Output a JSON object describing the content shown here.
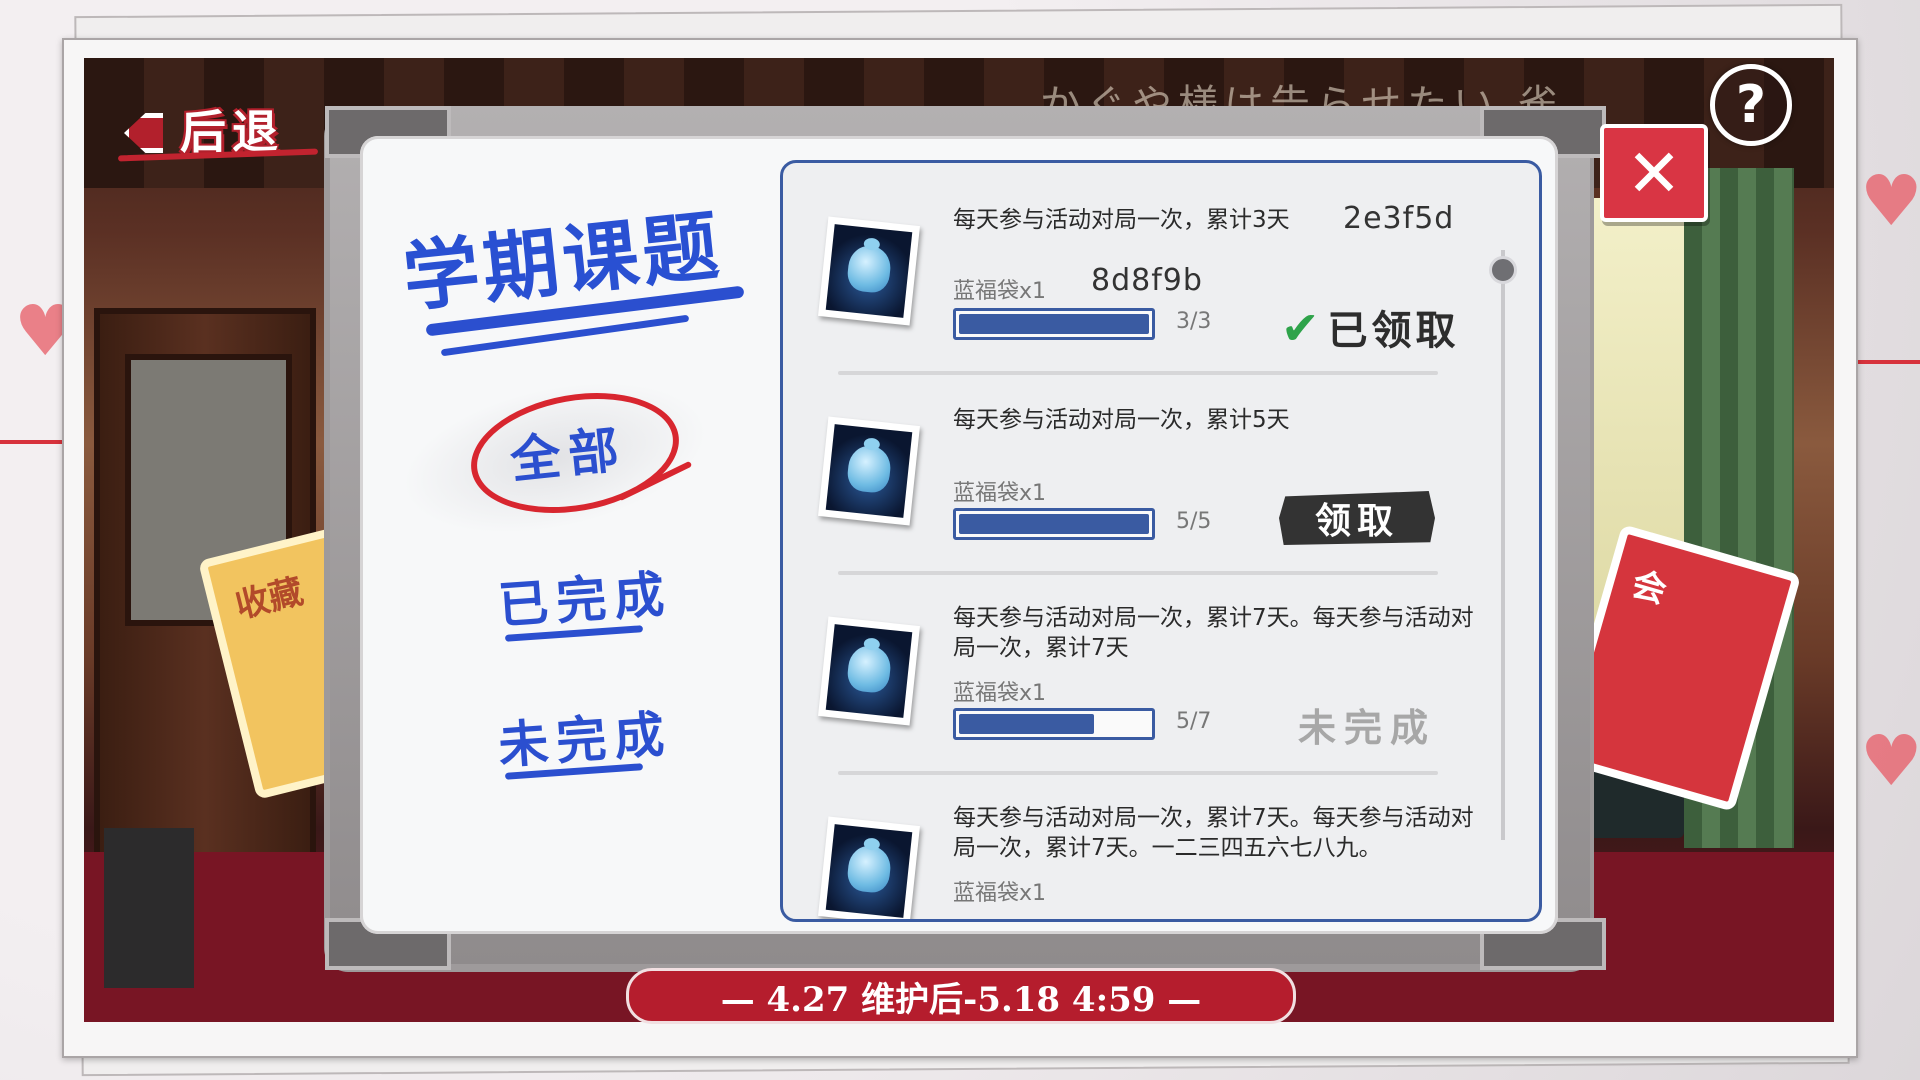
{
  "back_button": {
    "label": "后退"
  },
  "board": {
    "title": "学期课题",
    "filters": [
      {
        "label": "全部",
        "active": true
      },
      {
        "label": "已完成",
        "active": false
      },
      {
        "label": "未完成",
        "active": false
      }
    ]
  },
  "tasks": [
    {
      "description": "每天参与活动对局一次，累计3天",
      "reward": "蓝福袋x1",
      "progress": "3/3",
      "progress_ratio": 1.0,
      "status": "已领取",
      "code_a": "2e3f5d",
      "code_b": "8d8f9b",
      "icon": "blue-lucky-bag-icon"
    },
    {
      "description": "每天参与活动对局一次，累计5天",
      "reward": "蓝福袋x1",
      "progress": "5/5",
      "progress_ratio": 1.0,
      "status": "领取",
      "icon": "blue-lucky-bag-icon"
    },
    {
      "description": "每天参与活动对局一次，累计7天。每天参与活动对局一次，累计7天",
      "reward": "蓝福袋x1",
      "progress": "5/7",
      "progress_ratio": 0.714,
      "status": "未完成",
      "icon": "blue-lucky-bag-icon"
    },
    {
      "description": "每天参与活动对局一次，累计7天。每天参与活动对局一次，累计7天。一二三四五六七八九。",
      "reward": "蓝福袋x1",
      "icon": "blue-lucky-bag-icon"
    }
  ],
  "event_period": "— 4.27 维护后-5.18 4:59 —",
  "help_button": {
    "symbol": "?"
  },
  "close_button": {
    "symbol": "✕"
  },
  "background": {
    "game_title_faint": "かぐや様は告らせたい 雀",
    "card_left_text": "收藏",
    "card_right_text": "会"
  },
  "colors": {
    "accent_blue": "#2b4fcf",
    "accent_red": "#d8262f",
    "panel_border": "#3a5ba2",
    "claimed_check": "#2ea34a"
  }
}
